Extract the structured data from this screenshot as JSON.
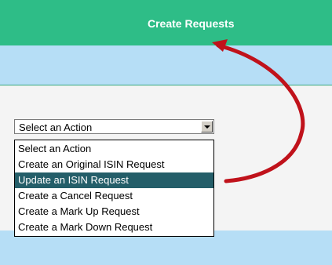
{
  "header": {
    "title": "Create Requests"
  },
  "action_select": {
    "current_value": "Select an Action",
    "options": [
      "Select an Action",
      "Create an Original ISIN Request",
      "Update an ISIN Request",
      "Create a Cancel Request",
      "Create a Mark Up Request",
      "Create a Mark Down Request"
    ],
    "highlighted_option": "Update an ISIN Request"
  },
  "colors": {
    "header_bg": "#2ebd87",
    "band_bg": "#b6def6",
    "content_bg": "#f4f4f4",
    "highlight_bg": "#245e69",
    "annotation": "#c0121b"
  },
  "icons": {
    "dropdown_arrow": "chevron-down-icon",
    "annotation_arrow": "curved-arrow-annotation"
  }
}
